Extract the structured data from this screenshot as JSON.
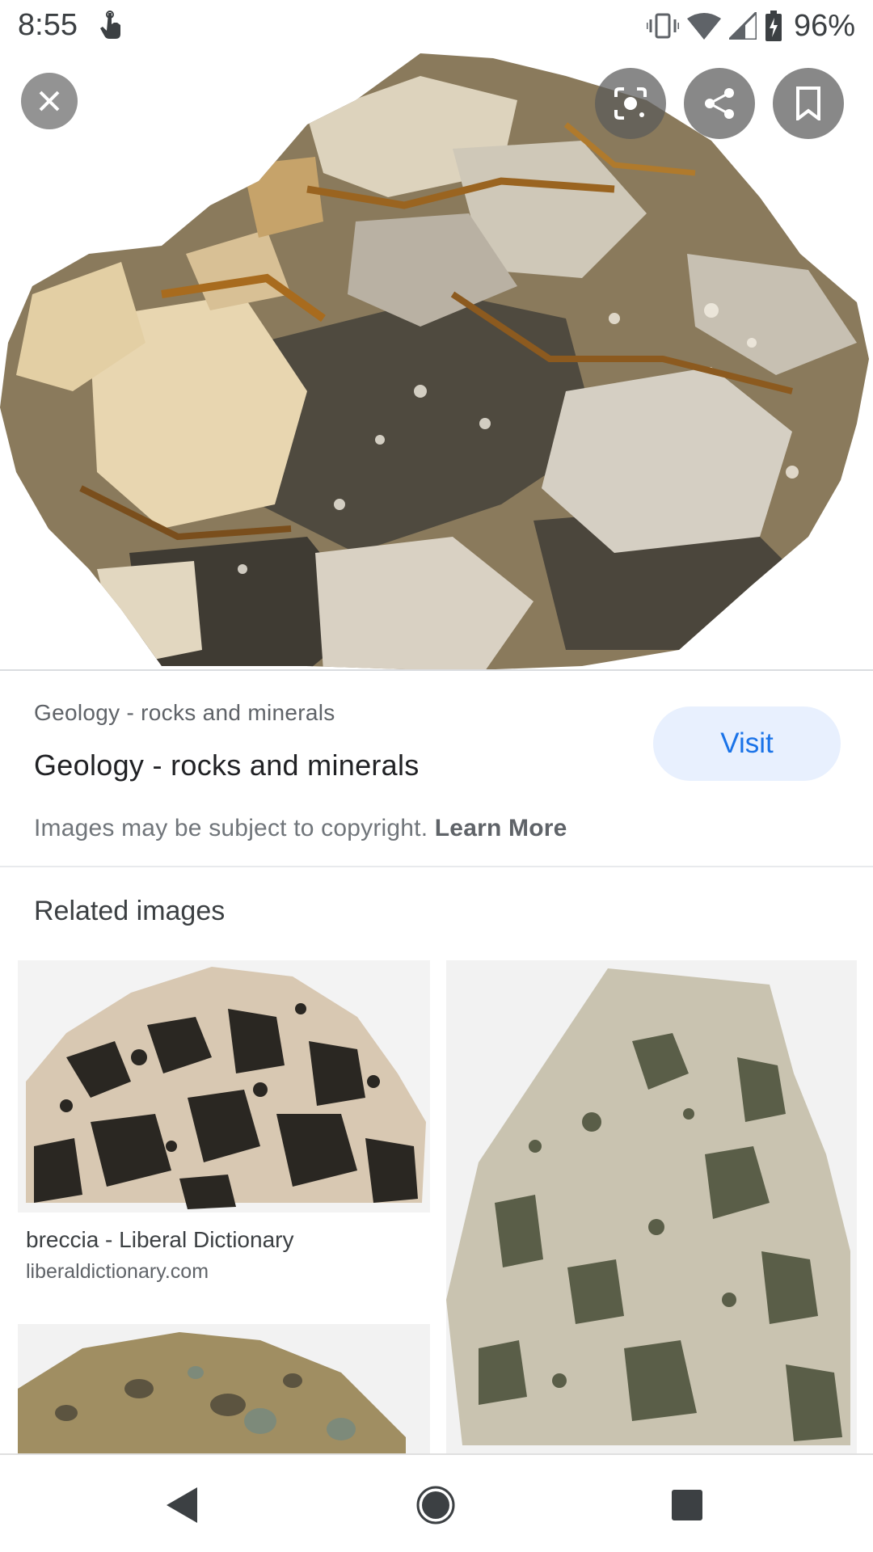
{
  "status_bar": {
    "time": "8:55",
    "battery": "96%",
    "icons": [
      "touch-icon",
      "vibrate-icon",
      "wifi-icon",
      "signal-icon",
      "battery-icon"
    ]
  },
  "viewer": {
    "overlay_icons": [
      "close-icon",
      "lens-icon",
      "share-icon",
      "bookmark-icon"
    ]
  },
  "result": {
    "source": "Geology - rocks and minerals",
    "title": "Geology - rocks and minerals",
    "visit_label": "Visit",
    "copyright_text": "Images may be subject to copyright.",
    "learn_more_label": "Learn More"
  },
  "related": {
    "heading": "Related images",
    "items": [
      {
        "title": "breccia - Liberal Dictionary",
        "domain": "liberaldictionary.com"
      }
    ]
  },
  "nav": {
    "icons": [
      "back-icon",
      "home-icon",
      "recents-icon"
    ]
  },
  "colors": {
    "accent": "#1a73e8",
    "visit_bg": "#e8f0fe",
    "secondary_text": "#5f6368"
  }
}
